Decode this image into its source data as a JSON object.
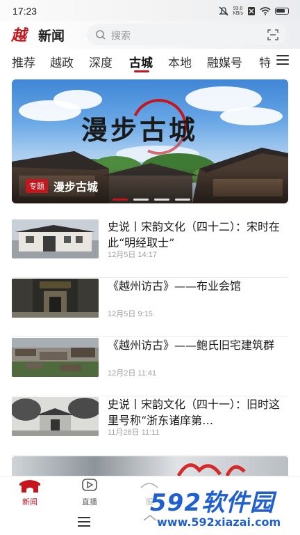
{
  "status_bar": {
    "time": "17:23",
    "net_speed_value": "93.0",
    "net_speed_unit": "KB/s"
  },
  "header": {
    "logo_mark": "越",
    "logo_text": "新闻",
    "search_placeholder": "搜索"
  },
  "tabs": [
    "推荐",
    "越政",
    "深度",
    "古城",
    "本地",
    "融媒号",
    "特"
  ],
  "active_tab": "古城",
  "banner": {
    "title_art": "漫步古城",
    "badge": "专题",
    "caption": "漫步古城",
    "slide_count": 4,
    "active_slide": 1
  },
  "news": [
    {
      "title": "史说丨宋韵文化（四十二）：宋时在此“明经取士”",
      "date": "12月5日  14:17"
    },
    {
      "title": "《越州访古》——布业会馆",
      "date": "12月5日  9:15"
    },
    {
      "title": "《越州访古》——鲍氏旧宅建筑群",
      "date": "12月2日  11:41"
    },
    {
      "title": "史说丨宋韵文化（四十一）：旧时这里号称“浙东诸庠第…",
      "date": "11月28日  11:11"
    }
  ],
  "bottom_nav": [
    {
      "label": "新闻",
      "icon": "gate-icon",
      "active": true
    },
    {
      "label": "直播",
      "icon": "play-icon",
      "active": false
    },
    {
      "label": "服",
      "icon": "service-icon",
      "active": false
    }
  ],
  "watermark": {
    "main": "592软件园",
    "url": "www.592xiazai.com"
  },
  "colors": {
    "accent": "#c5161d",
    "watermark": "#1f5fcf"
  }
}
